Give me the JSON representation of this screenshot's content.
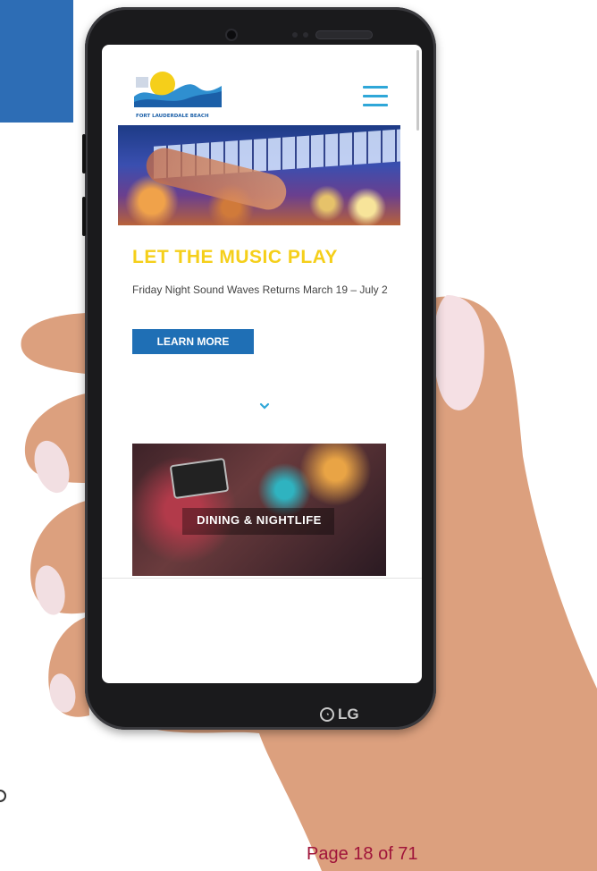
{
  "site": {
    "logo_text": "FORT LAUDERDALE BEACH",
    "hero": {
      "headline": "LET THE MUSIC PLAY",
      "subtext": "Friday Night Sound Waves Returns March 19 – July 2",
      "button_label": "LEARN MORE"
    },
    "card": {
      "label": "DINING & NIGHTLIFE"
    }
  },
  "device": {
    "brand": "LG"
  },
  "page": {
    "number": "Page 18 of 71"
  },
  "icons": {
    "menu": "hamburger-menu-icon",
    "scroll": "chevron-down-icon",
    "logo": "wave-sun-logo-icon"
  },
  "colors": {
    "accent_yellow": "#f5cf1a",
    "button_blue": "#1f6fb5",
    "menu_teal": "#2fa7d8",
    "corner_blue": "#2d6db5",
    "page_number": "#a0143a"
  }
}
